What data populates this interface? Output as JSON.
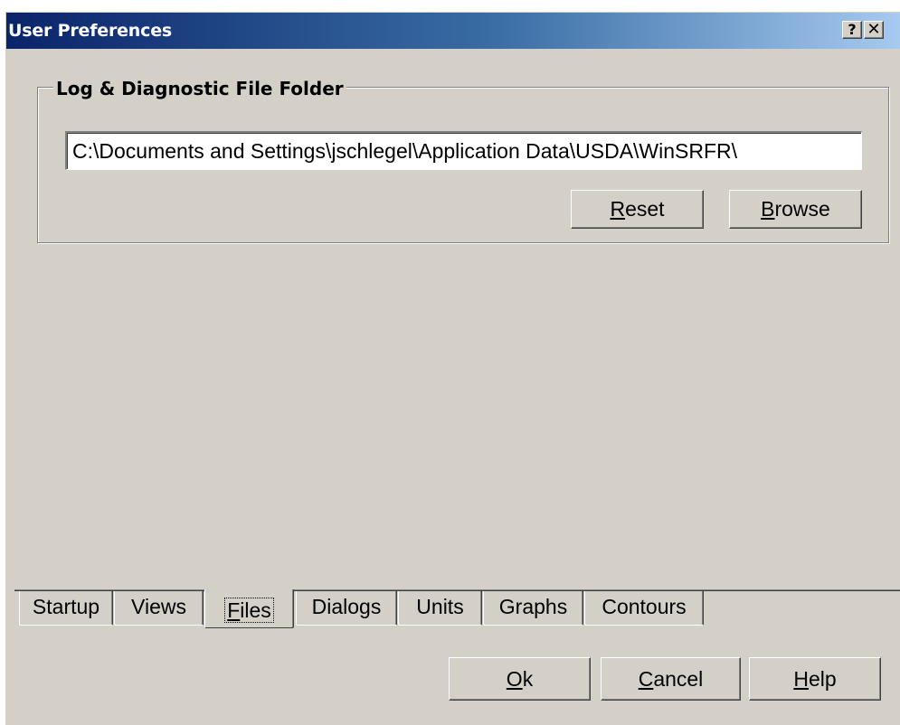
{
  "window": {
    "title": "User Preferences",
    "help_glyph": "?",
    "close_glyph": "✕"
  },
  "group": {
    "title": "Log & Diagnostic File Folder",
    "path_value": "C:\\Documents and Settings\\jschlegel\\Application Data\\USDA\\WinSRFR\\",
    "reset": {
      "mnemonic": "R",
      "rest": "eset"
    },
    "browse": {
      "mnemonic": "B",
      "rest": "rowse"
    }
  },
  "tabs": [
    {
      "label": "Startup",
      "selected": false
    },
    {
      "label": "Views",
      "selected": false
    },
    {
      "label": "Files",
      "mnemonic": "F",
      "rest": "iles",
      "selected": true
    },
    {
      "label": "Dialogs",
      "selected": false
    },
    {
      "label": "Units",
      "selected": false
    },
    {
      "label": "Graphs",
      "selected": false
    },
    {
      "label": "Contours",
      "selected": false
    }
  ],
  "footer": {
    "ok": {
      "mnemonic": "O",
      "rest": "k"
    },
    "cancel": {
      "mnemonic": "C",
      "rest": "ancel"
    },
    "help": {
      "mnemonic": "H",
      "rest": "elp"
    }
  },
  "icons": {
    "help": "help-question-icon",
    "close": "close-icon"
  },
  "colors": {
    "titlebar_start": "#0a246a",
    "titlebar_end": "#a6caf0",
    "face": "#d4d0c8"
  }
}
